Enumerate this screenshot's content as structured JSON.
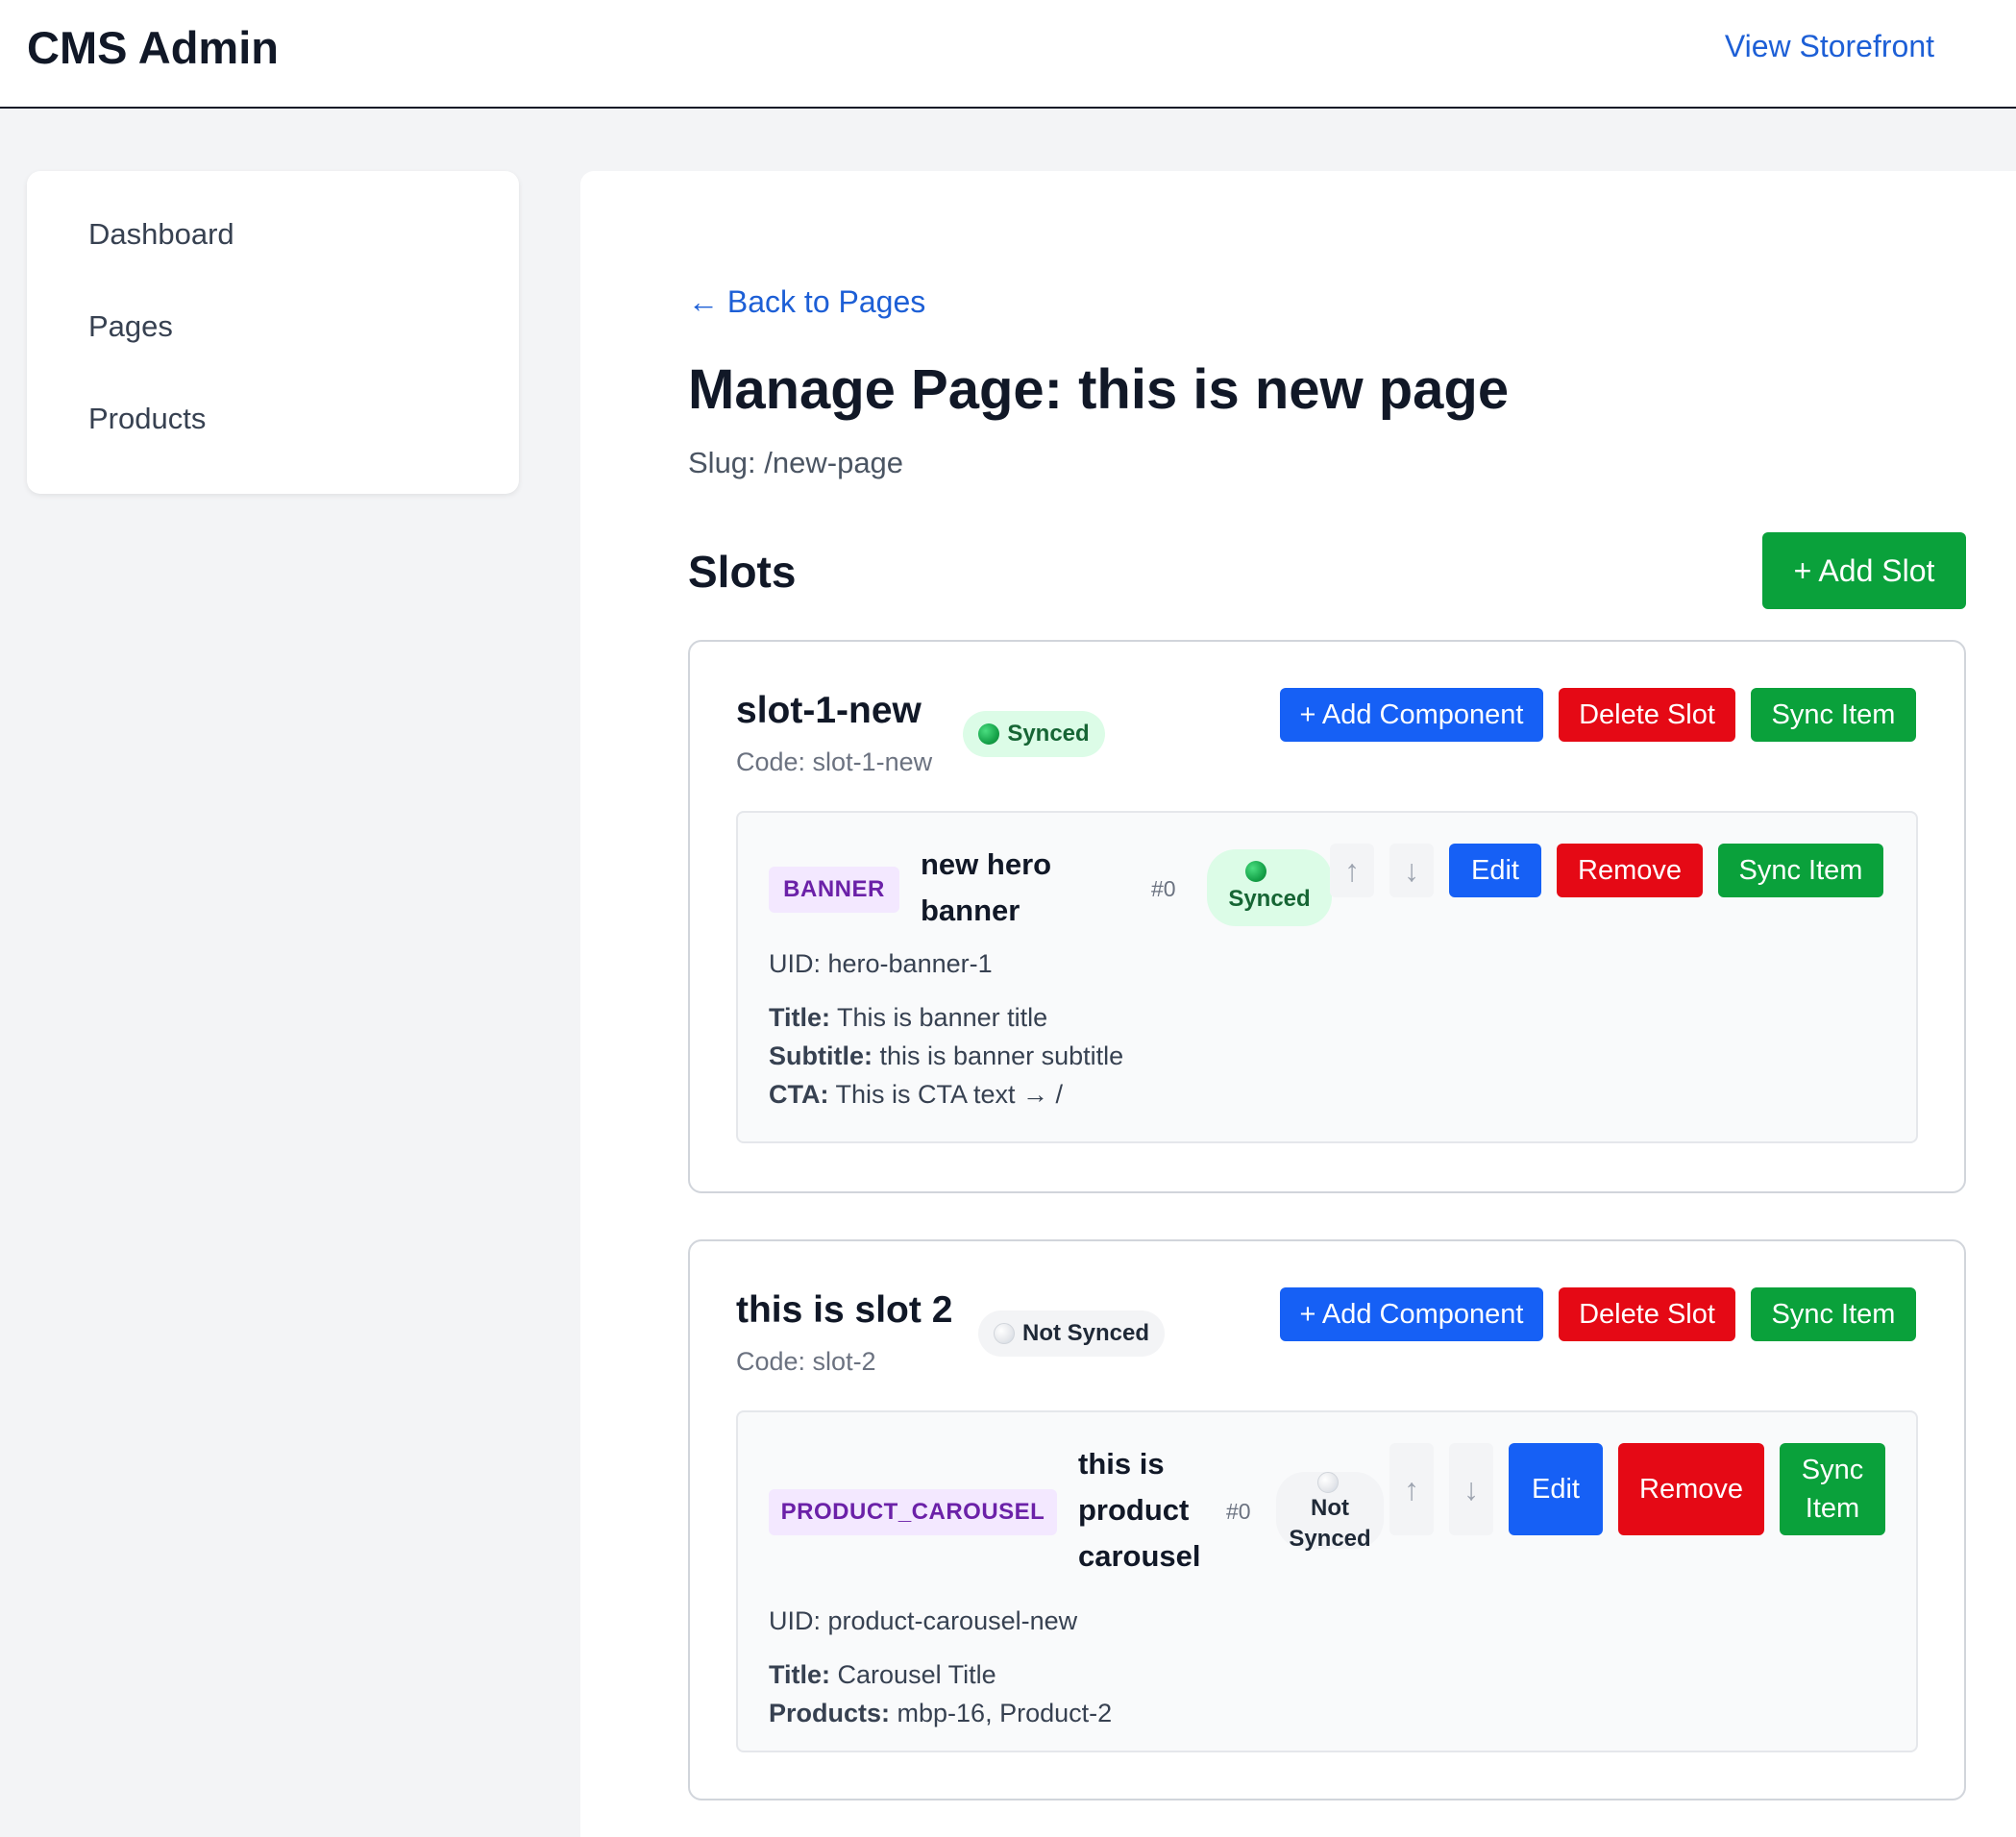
{
  "header": {
    "brand": "CMS Admin",
    "storefront_link": "View Storefront"
  },
  "sidebar": {
    "items": [
      {
        "label": "Dashboard"
      },
      {
        "label": "Pages"
      },
      {
        "label": "Products"
      }
    ]
  },
  "main": {
    "back_link": "← Back to Pages",
    "title": "Manage Page: this is new page",
    "slug": "Slug: /new-page",
    "slots_heading": "Slots",
    "add_slot_label": "+ Add Slot"
  },
  "slot_actions": {
    "add_component": "+ Add Component",
    "delete_slot": "Delete Slot",
    "sync_item": "Sync Item"
  },
  "component_actions": {
    "up": "↑",
    "down": "↓",
    "edit": "Edit",
    "remove": "Remove",
    "sync": "Sync Item"
  },
  "slots": [
    {
      "name": "slot-1-new",
      "code": "Code: slot-1-new",
      "status": "Synced",
      "components": [
        {
          "type": "BANNER",
          "name": "new hero banner",
          "index": "#0",
          "status": "Synced",
          "uid": "UID: hero-banner-1",
          "fields": [
            {
              "label": "Title:",
              "value": "This is banner title"
            },
            {
              "label": "Subtitle:",
              "value": "this is banner subtitle"
            },
            {
              "label": "CTA:",
              "value": "This is CTA text → /"
            }
          ]
        }
      ]
    },
    {
      "name": "this is slot 2",
      "code": "Code: slot-2",
      "status": "Not Synced",
      "components": [
        {
          "type": "PRODUCT_CAROUSEL",
          "name": "this is product carousel",
          "index": "#0",
          "status": "Not Synced",
          "uid": "UID: product-carousel-new",
          "fields": [
            {
              "label": "Title:",
              "value": "Carousel Title"
            },
            {
              "label": "Products:",
              "value": "mbp-16, Product-2"
            }
          ]
        }
      ]
    }
  ],
  "colors": {
    "primary_blue": "#1660f5",
    "success_green": "#0aa13b",
    "danger_red": "#e50915",
    "link_blue": "#1d5fd6",
    "type_badge_purple": "#6b21a8"
  }
}
